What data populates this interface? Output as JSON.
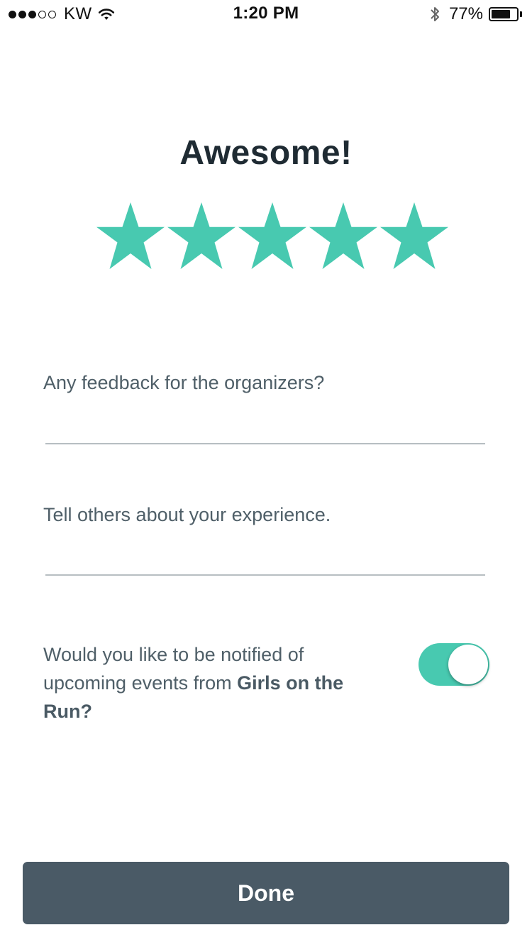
{
  "status_bar": {
    "signal_bars_filled": 3,
    "signal_bars_total": 5,
    "carrier": "KW",
    "time": "1:20 PM",
    "battery_percent_label": "77%",
    "battery_level": 0.77,
    "icons": [
      "wifi-icon",
      "bluetooth-icon",
      "battery-icon"
    ]
  },
  "header": {
    "title": "Awesome!"
  },
  "rating": {
    "value": 5,
    "max": 5,
    "icon": "star-icon",
    "color_on": "#48c9b0"
  },
  "feedback": {
    "label": "Any feedback for the organizers?",
    "value": ""
  },
  "experience": {
    "label": "Tell others about your experience.",
    "value": ""
  },
  "notify": {
    "text_before": "Would you like to be notified of upcoming events from ",
    "organizer": "Girls on the Run?",
    "enabled": true,
    "toggle_color": "#48c9b0"
  },
  "footer": {
    "done_label": "Done",
    "button_color": "#4a5a66"
  }
}
